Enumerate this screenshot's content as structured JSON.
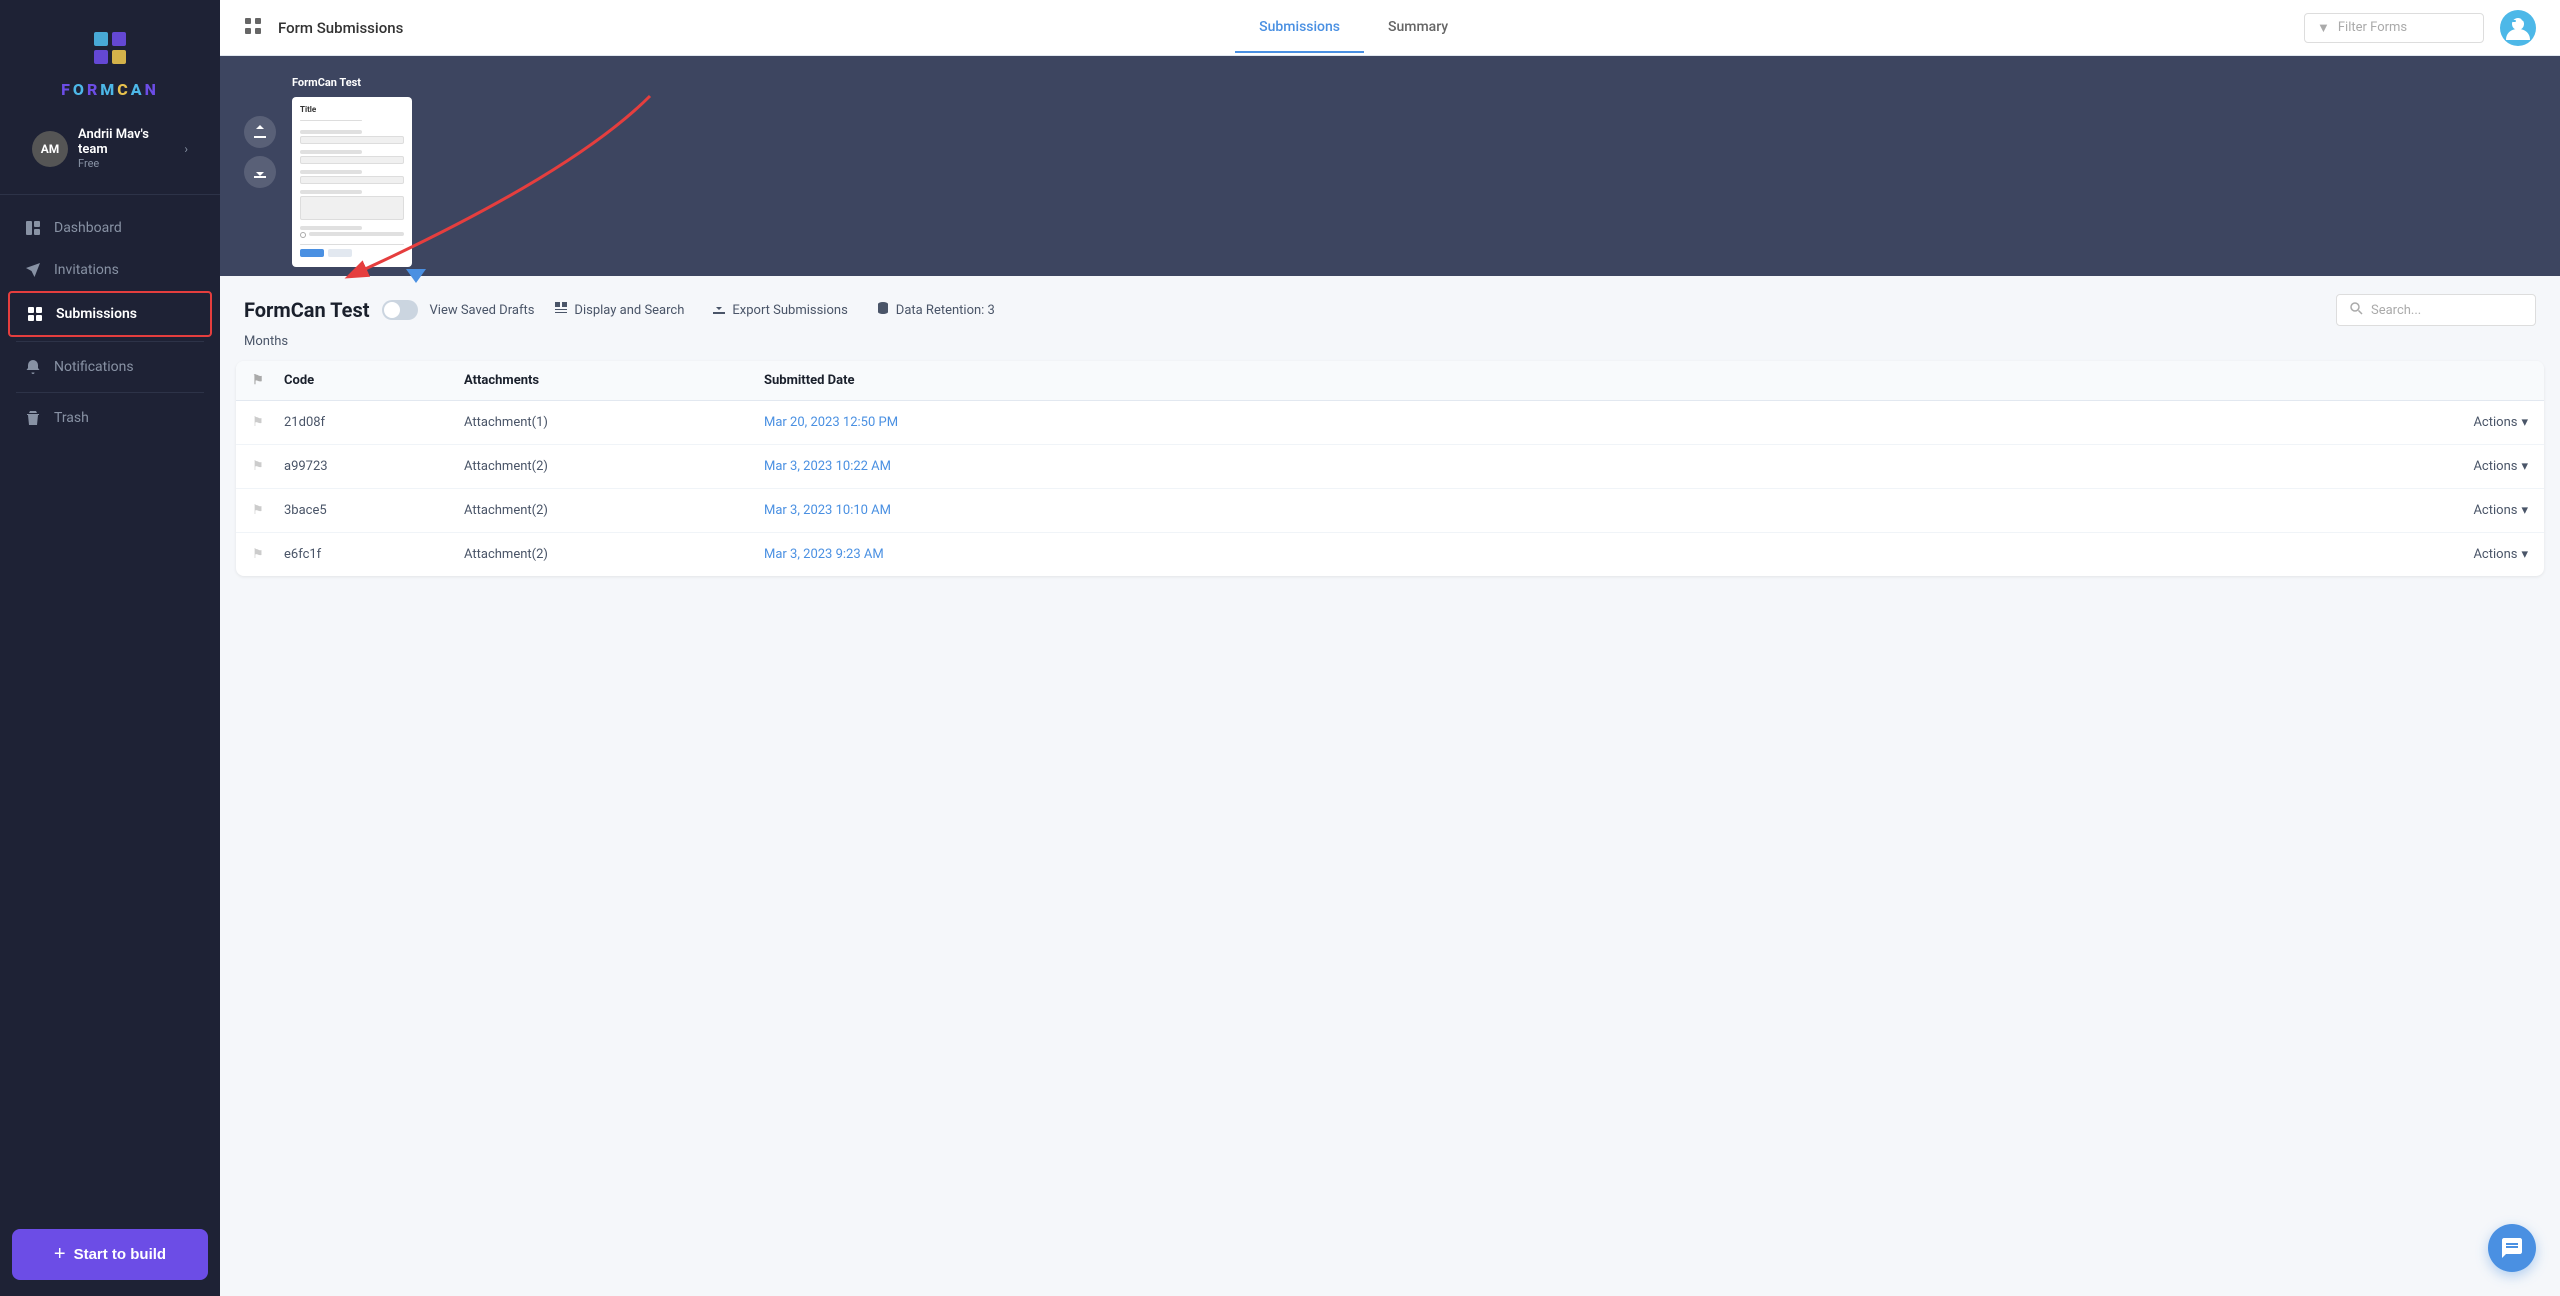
{
  "sidebar": {
    "logo_text": "FORMCAN",
    "team": {
      "initials": "AM",
      "name": "Andrii Mav's team",
      "plan": "Free"
    },
    "nav_items": [
      {
        "id": "dashboard",
        "label": "Dashboard",
        "icon": "columns-icon"
      },
      {
        "id": "invitations",
        "label": "Invitations",
        "icon": "send-icon"
      },
      {
        "id": "submissions",
        "label": "Submissions",
        "icon": "grid-icon",
        "active": true
      },
      {
        "id": "notifications",
        "label": "Notifications",
        "icon": "bell-icon"
      },
      {
        "id": "trash",
        "label": "Trash",
        "icon": "trash-icon"
      }
    ],
    "start_build_label": "Start to build"
  },
  "topbar": {
    "grid_label": "⊞",
    "title": "Form Submissions",
    "tabs": [
      {
        "id": "submissions",
        "label": "Submissions",
        "active": true
      },
      {
        "id": "summary",
        "label": "Summary",
        "active": false
      }
    ],
    "filter_placeholder": "Filter Forms"
  },
  "form_preview": {
    "title": "FormCan Test",
    "preview_label": "FormCan Test"
  },
  "submissions": {
    "title": "FormCan Test",
    "toggle_label": "View Saved Drafts",
    "actions": [
      {
        "label": "Display and Search",
        "icon": "layout-icon"
      },
      {
        "label": "Export Submissions",
        "icon": "download-icon"
      },
      {
        "label": "Data Retention: 3",
        "icon": "database-icon"
      }
    ],
    "months_label": "Months",
    "search_placeholder": "Search...",
    "table": {
      "columns": [
        "",
        "Code",
        "Attachments",
        "Submitted Date",
        ""
      ],
      "rows": [
        {
          "code": "21d08f",
          "attachments": "Attachment(1)",
          "date": "Mar 20, 2023 12:50 PM",
          "actions": "Actions"
        },
        {
          "code": "a99723",
          "attachments": "Attachment(2)",
          "date": "Mar 3, 2023 10:22 AM",
          "actions": "Actions"
        },
        {
          "code": "3bace5",
          "attachments": "Attachment(2)",
          "date": "Mar 3, 2023 10:10 AM",
          "actions": "Actions"
        },
        {
          "code": "e6fc1f",
          "attachments": "Attachment(2)",
          "date": "Mar 3, 2023 9:23 AM",
          "actions": "Actions"
        }
      ]
    }
  },
  "icons": {
    "plus": "+",
    "chevron_right": "›",
    "chevron_down": "▼",
    "filter": "⊟",
    "search": "🔍",
    "upload": "↑",
    "download_circle": "↓",
    "flag": "⚑",
    "chat": "💬",
    "grid": "⊞",
    "bell": "🔔",
    "trash": "🗑",
    "send": "✈",
    "columns": "▦",
    "layout": "▤",
    "database": "🗄",
    "export": "⬇"
  }
}
